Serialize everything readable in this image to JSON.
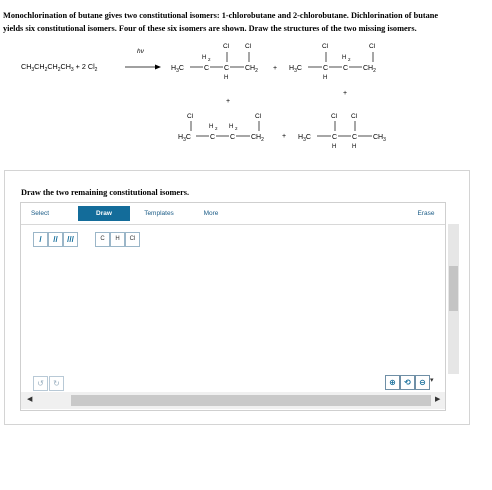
{
  "question": {
    "line1": "Monochlorination of butane gives two constitutional isomers: 1-chlorobutane and 2-chlorobutane. Dichlorination of butane",
    "line2": "yields six constitutional isomers. Four of these six isomers are shown. Draw the structures of the two missing isomers."
  },
  "reaction": {
    "reactant_a": "CH",
    "reactant_sub3": "3",
    "reactant_mid1": "CH",
    "reactant_sub2a": "2",
    "reactant_mid2": "CH",
    "reactant_sub2b": "2",
    "reactant_mid3": "CH",
    "reactant_sub3b": "3",
    "reactant_plus": " + 2 Cl",
    "reactant_sub2c": "2",
    "condition": "hν",
    "plus": "+",
    "cl": "Cl",
    "h": "H",
    "h2": "H",
    "h2sub": "2",
    "c": "C",
    "h3c": "H",
    "h3c_sub": "3",
    "h3c_c": "C",
    "ch2": "CH",
    "ch2_sub": "2",
    "ch3": "CH",
    "ch3_sub": "3"
  },
  "panel": {
    "instruction": "Draw the two remaining constitutional isomers."
  },
  "toolbar": {
    "select": "Select",
    "draw": "Draw",
    "templates": "Templates",
    "more": "More",
    "erase": "Erase"
  },
  "tools": {
    "single_bond": "/",
    "double_bond": "//",
    "triple_bond": "///",
    "atom_c": "C",
    "atom_h": "H",
    "atom_cl": "Cl"
  },
  "icons": {
    "undo": "undo-icon",
    "redo": "redo-icon",
    "zoom_in": "zoom-in-icon",
    "zoom_reset": "zoom-reset-icon",
    "zoom_out": "zoom-out-icon"
  },
  "colors": {
    "accent": "#136c9a",
    "link": "#1a5b86"
  }
}
